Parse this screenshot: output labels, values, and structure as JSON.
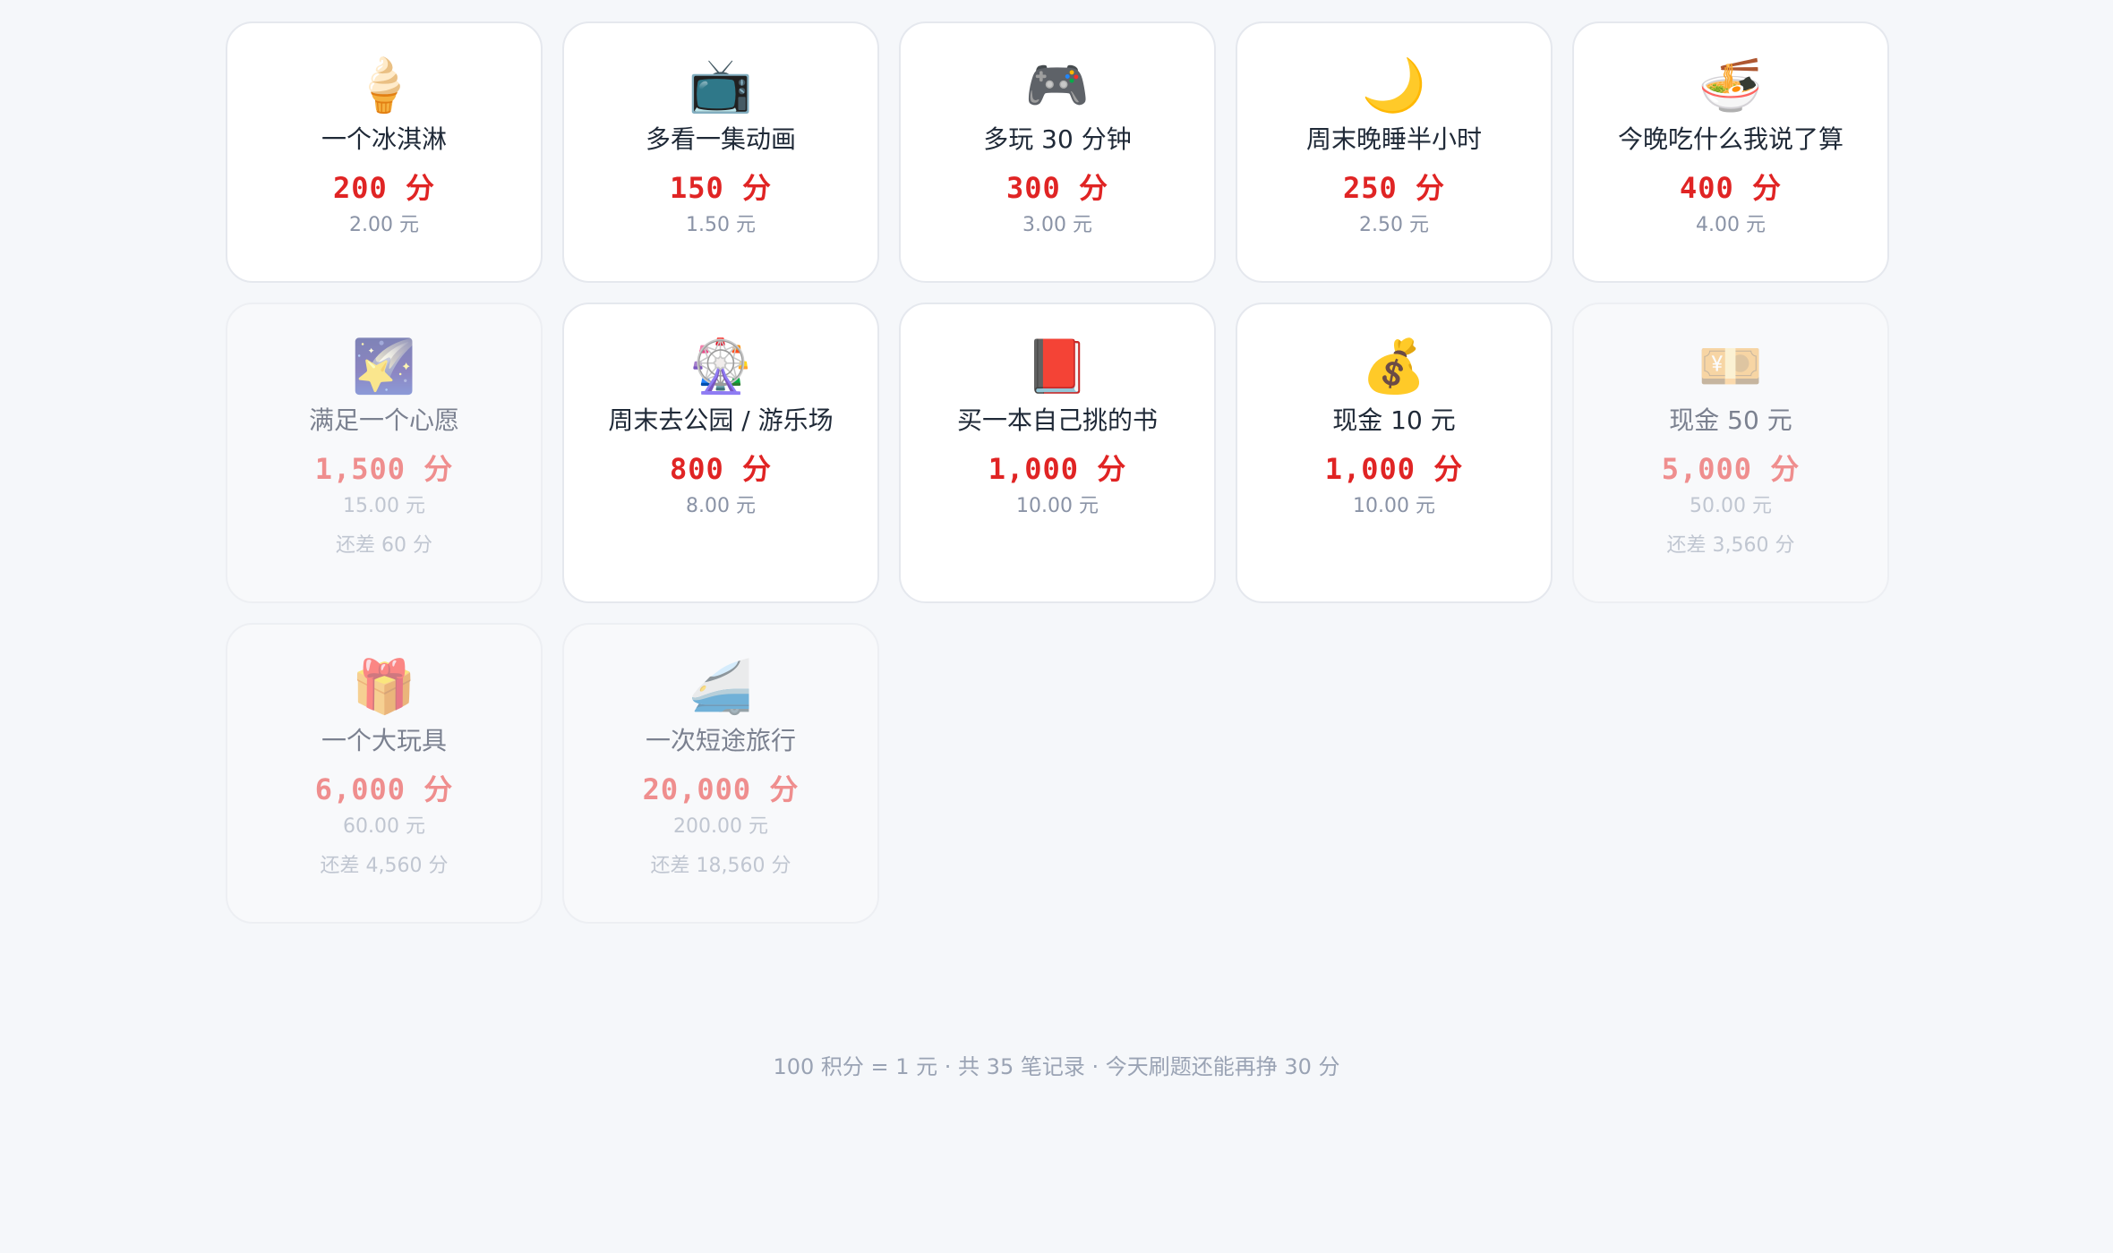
{
  "rewards": [
    {
      "icon": "soft-ice-cream-icon",
      "emoji": "🍦",
      "name": "一个冰淇淋",
      "points": "200 分",
      "yuan": "2.00 元",
      "locked": false
    },
    {
      "icon": "television-icon",
      "emoji": "📺",
      "name": "多看一集动画",
      "points": "150 分",
      "yuan": "1.50 元",
      "locked": false
    },
    {
      "icon": "game-controller-icon",
      "emoji": "🎮",
      "name": "多玩 30 分钟",
      "points": "300 分",
      "yuan": "3.00 元",
      "locked": false
    },
    {
      "icon": "crescent-moon-icon",
      "emoji": "🌙",
      "name": "周末晚睡半小时",
      "points": "250 分",
      "yuan": "2.50 元",
      "locked": false
    },
    {
      "icon": "noodle-bowl-icon",
      "emoji": "🍜",
      "name": "今晚吃什么我说了算",
      "points": "400 分",
      "yuan": "4.00 元",
      "locked": false
    },
    {
      "icon": "shooting-star-icon",
      "emoji": "🌠",
      "name": "满足一个心愿",
      "points": "1,500 分",
      "yuan": "15.00 元",
      "lack": "还差 60 分",
      "locked": true
    },
    {
      "icon": "ferris-wheel-icon",
      "emoji": "🎡",
      "name": "周末去公园 / 游乐场",
      "points": "800 分",
      "yuan": "8.00 元",
      "locked": false
    },
    {
      "icon": "red-book-icon",
      "emoji": "📕",
      "name": "买一本自己挑的书",
      "points": "1,000 分",
      "yuan": "10.00 元",
      "locked": false
    },
    {
      "icon": "money-bag-icon",
      "emoji": "💰",
      "name": "现金 10 元",
      "points": "1,000 分",
      "yuan": "10.00 元",
      "locked": false
    },
    {
      "icon": "yen-banknote-icon",
      "emoji": "💴",
      "name": "现金 50 元",
      "points": "5,000 分",
      "yuan": "50.00 元",
      "lack": "还差 3,560 分",
      "locked": true
    },
    {
      "icon": "gift-icon",
      "emoji": "🎁",
      "name": "一个大玩具",
      "points": "6,000 分",
      "yuan": "60.00 元",
      "lack": "还差 4,560 分",
      "locked": true
    },
    {
      "icon": "bullet-train-icon",
      "emoji": "🚄",
      "name": "一次短途旅行",
      "points": "20,000 分",
      "yuan": "200.00 元",
      "lack": "还差 18,560 分",
      "locked": true
    }
  ],
  "footer": {
    "text": "100 积分 = 1 元 · 共 35 笔记录 · 今天刷题还能再挣 30 分"
  },
  "colors": {
    "background": "#f5f7fa",
    "points_red": "#e02424",
    "points_red_locked": "#ef8e8e",
    "muted_text": "#8a93a6"
  }
}
